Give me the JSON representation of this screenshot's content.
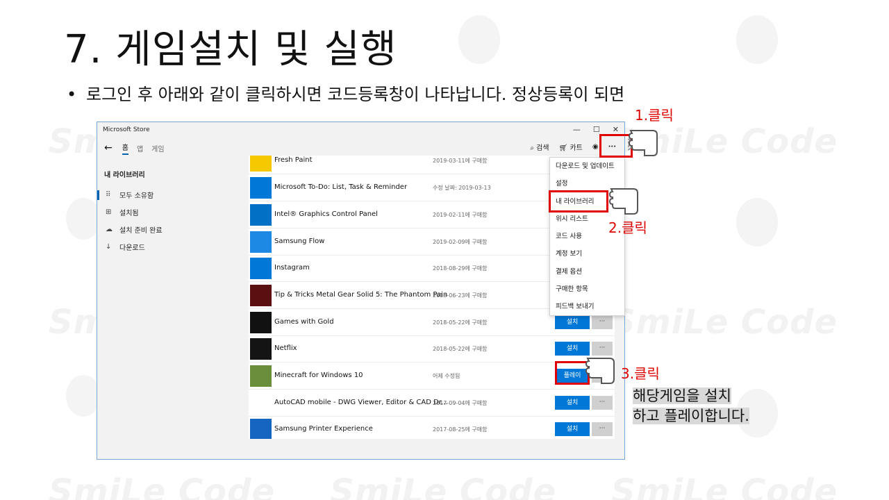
{
  "slide": {
    "title": "7. 게임설치 및 실행",
    "bullet": "로그인 후 아래와 같이 클릭하시면 코드등록창이 나타납니다. 정상등록이 되면",
    "watermark": "SmiLe Code"
  },
  "store": {
    "window_title": "Microsoft Store",
    "window_controls": [
      "—",
      "☐",
      "✕"
    ],
    "nav_tabs": [
      "홈",
      "앱",
      "게임"
    ],
    "search_label": "검색",
    "cart_label": "카트",
    "more_label": "···",
    "sidebar_title": "내 라이브러리",
    "sidebar_items": [
      {
        "label": "모두 소유함",
        "icon": "grid-dots-icon"
      },
      {
        "label": "설치됨",
        "icon": "installed-icon"
      },
      {
        "label": "설치 준비 완료",
        "icon": "cloud-icon"
      },
      {
        "label": "다운로드",
        "icon": "download-icon"
      }
    ],
    "apps": [
      {
        "name": "Fresh Paint",
        "date": "2019-03-11에 구매함",
        "thumb_color": "#f5c800",
        "install": "",
        "more": ""
      },
      {
        "name": "Microsoft To-Do: List, Task & Reminder",
        "date": "수정 날짜: 2019-03-13",
        "thumb_color": "#0078d7",
        "install": "",
        "more": ""
      },
      {
        "name": "Intel® Graphics Control Panel",
        "date": "2019-02-11에 구매함",
        "thumb_color": "#0071c5",
        "install": "",
        "more": ""
      },
      {
        "name": "Samsung Flow",
        "date": "2019-02-09에 구매함",
        "thumb_color": "#1e88e5",
        "install": "",
        "more": ""
      },
      {
        "name": "Instagram",
        "date": "2018-08-29에 구매함",
        "thumb_color": "#0078d7",
        "install": "",
        "more": ""
      },
      {
        "name": "Tip & Tricks Metal Gear Solid 5: The Phantom Pain",
        "date": "2018-06-23에 구매함",
        "thumb_color": "#5a1010",
        "install": "",
        "more": ""
      },
      {
        "name": "Games with Gold",
        "date": "2018-05-22에 구매함",
        "thumb_color": "#111111",
        "install": "설치",
        "more": "···"
      },
      {
        "name": "Netflix",
        "date": "2018-05-22에 구매함",
        "thumb_color": "#141414",
        "install": "설치",
        "more": "···"
      },
      {
        "name": "Minecraft for Windows 10",
        "date": "어제 수정됨",
        "thumb_color": "#6b8e3d",
        "install": "플레이",
        "more": "···"
      },
      {
        "name": "AutoCAD mobile - DWG Viewer, Editor & CAD Dr...",
        "date": "2017-09-04에 구매함",
        "thumb_color": "#ffffff",
        "install": "설치",
        "more": "···"
      },
      {
        "name": "Samsung Printer Experience",
        "date": "2017-08-25에 구매함",
        "thumb_color": "#1565c0",
        "install": "설치",
        "more": "···"
      }
    ],
    "menu_items": [
      "다운로드 및 업데이트",
      "설정",
      "내 라이브러리",
      "위시 리스트",
      "코드 사용",
      "계정 보기",
      "결제 옵션",
      "구매한 항목",
      "피드백 보내기"
    ]
  },
  "annotations": {
    "step1": "1.클릭",
    "step2": "2.클릭",
    "step3": "3.클릭",
    "note_line1": "해당게임을 설치",
    "note_line2": "하고 플레이합니다.",
    "highlight_color": "#e00000"
  }
}
